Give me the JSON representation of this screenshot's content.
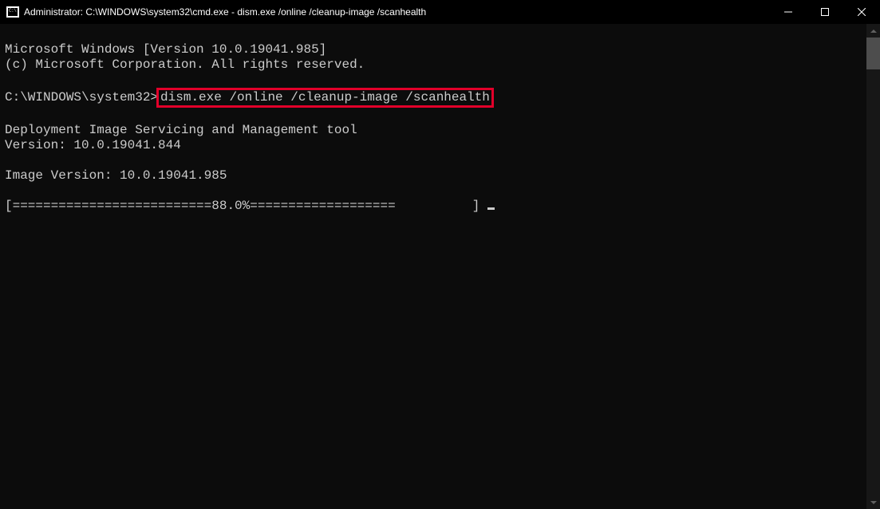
{
  "titlebar": {
    "text": "Administrator: C:\\WINDOWS\\system32\\cmd.exe - dism.exe  /online /cleanup-image /scanhealth"
  },
  "terminal": {
    "line_ms_windows": "Microsoft Windows [Version 10.0.19041.985]",
    "line_copyright": "(c) Microsoft Corporation. All rights reserved.",
    "prompt_prefix": "C:\\WINDOWS\\system32>",
    "command_highlighted": "dism.exe /online /cleanup-image /scanhealth",
    "line_dism_title": "Deployment Image Servicing and Management tool",
    "line_dism_version": "Version: 10.0.19041.844",
    "line_image_version": "Image Version: 10.0.19041.985",
    "progress_line": "[==========================88.0%===================          ] "
  }
}
